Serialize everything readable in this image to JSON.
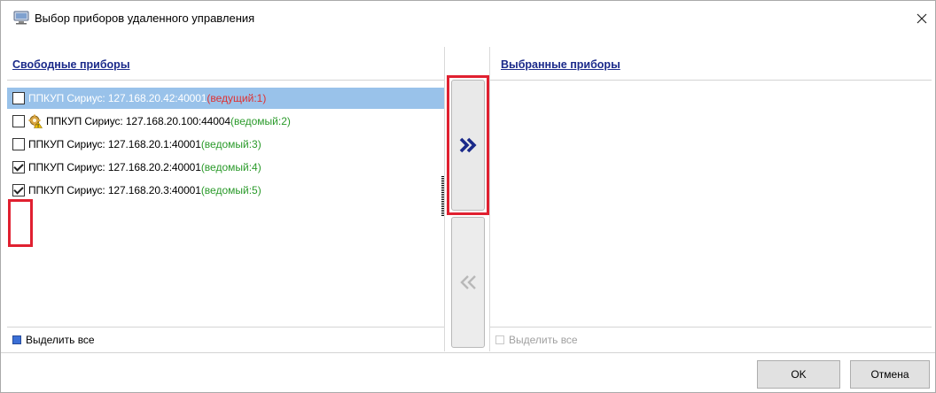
{
  "window": {
    "title": "Выбор приборов удаленного управления",
    "icon": "computer-icon"
  },
  "left_panel": {
    "header": "Свободные приборы",
    "select_all_label": "Выделить все",
    "items": [
      {
        "device": "ППКУП Сириус: 127.168.20.42:40001",
        "role": "(ведущий:1)",
        "role_type": "master",
        "checked": false,
        "selected": true,
        "icon": null
      },
      {
        "device": "ППКУП Сириус: 127.168.20.100:44004",
        "role": "(ведомый:2)",
        "role_type": "slave",
        "checked": false,
        "selected": false,
        "icon": "gear-warning-icon"
      },
      {
        "device": "ППКУП Сириус: 127.168.20.1:40001",
        "role": "(ведомый:3)",
        "role_type": "slave",
        "checked": false,
        "selected": false,
        "icon": null
      },
      {
        "device": "ППКУП Сириус: 127.168.20.2:40001",
        "role": "(ведомый:4)",
        "role_type": "slave",
        "checked": true,
        "selected": false,
        "icon": null
      },
      {
        "device": "ППКУП Сириус: 127.168.20.3:40001",
        "role": "(ведомый:5)",
        "role_type": "slave",
        "checked": true,
        "selected": false,
        "icon": null
      }
    ]
  },
  "right_panel": {
    "header": "Выбранные приборы",
    "select_all_label": "Выделить все",
    "items": []
  },
  "buttons": {
    "add": "»",
    "remove": "«",
    "ok": "OK",
    "cancel": "Отмена"
  },
  "colors": {
    "header_link": "#1b2a8a",
    "selected_row": "#99c2ea",
    "master_role": "#e03030",
    "slave_role": "#2a9a2a",
    "highlight": "#e02030"
  }
}
